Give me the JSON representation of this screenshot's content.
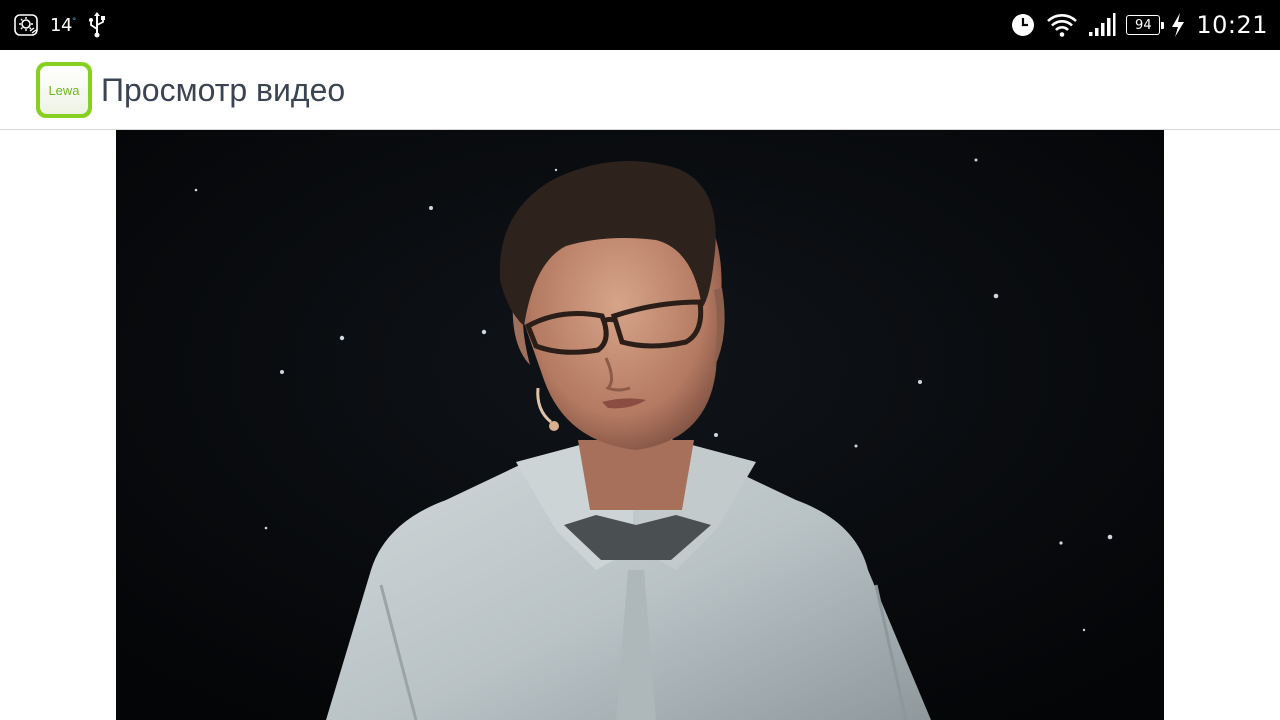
{
  "status_bar": {
    "temperature": "14",
    "degree": "°",
    "battery": "94",
    "time": "10:21",
    "icons": [
      "weather-icon",
      "usb-icon",
      "alarm-clock-icon",
      "wifi-icon",
      "signal-icon",
      "battery-icon",
      "charging-icon"
    ]
  },
  "app_bar": {
    "logo_text": "Lewa",
    "title": "Просмотр видео"
  },
  "colors": {
    "logo_green": "#87d020",
    "title_text": "#3b4453",
    "status_bar_bg": "#000000",
    "video_bg": "#06080b"
  }
}
